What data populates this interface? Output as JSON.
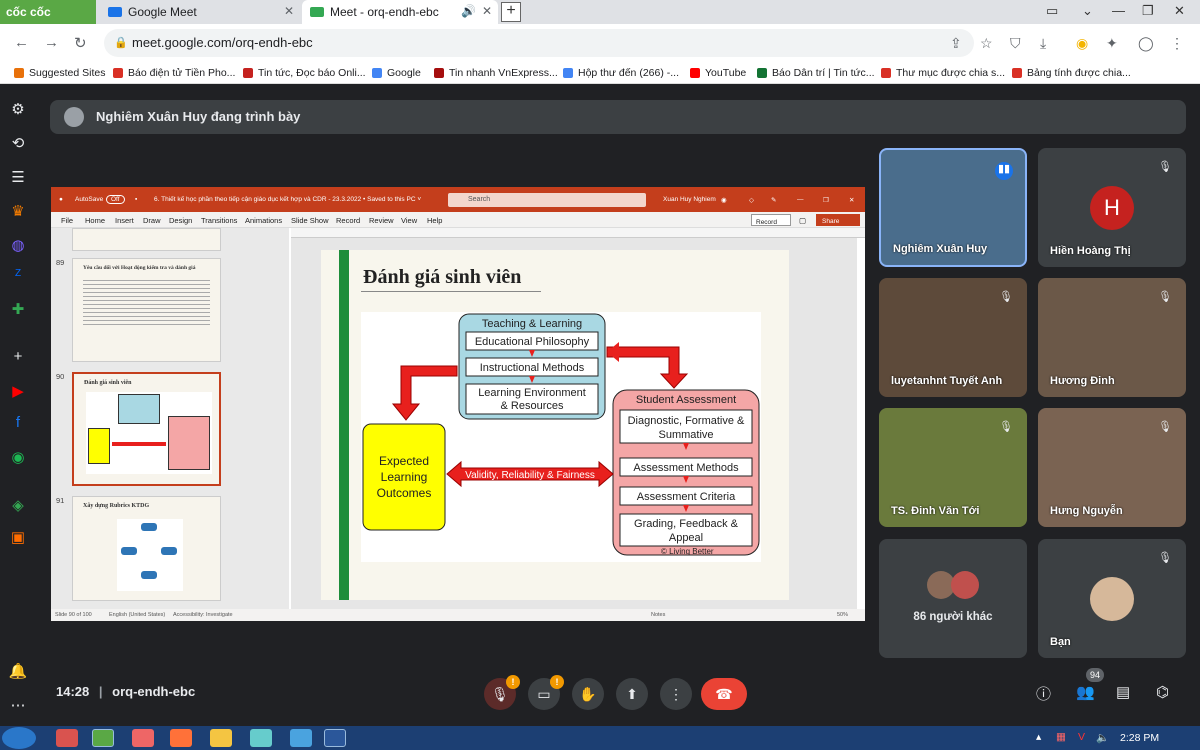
{
  "browser": {
    "logo": "cốc cốc",
    "tabs": [
      {
        "title": "Google Meet",
        "color": "#1a73e8"
      },
      {
        "title": "Meet - orq-endh-ebc",
        "color": "#34a853"
      }
    ],
    "new_tab": "+",
    "url": "meet.google.com/orq-endh-ebc",
    "bookmarks": [
      {
        "label": "Suggested Sites",
        "color": "#e8710a"
      },
      {
        "label": "Báo điện tử Tiền Pho...",
        "color": "#d93025"
      },
      {
        "label": "Tin tức, Đọc báo Onli...",
        "color": "#c5221f"
      },
      {
        "label": "Google",
        "color": "#4285f4"
      },
      {
        "label": "Tin nhanh VnExpress...",
        "color": "#a50e0e"
      },
      {
        "label": "Hộp thư đến (266) -...",
        "color": "#4285f4"
      },
      {
        "label": "YouTube",
        "color": "#ff0000"
      },
      {
        "label": "Báo Dân trí | Tin tức...",
        "color": "#137333"
      },
      {
        "label": "Thư mục được chia s...",
        "color": "#d93025"
      },
      {
        "label": "Bảng tính được chia...",
        "color": "#d93025"
      }
    ]
  },
  "presenting": "Nghiêm Xuân Huy đang trình bày",
  "ppt": {
    "autosave": "AutoSave",
    "autosave_state": "Off",
    "filename": "6. Thiết kế học phần theo tiếp cận giáo dục kết hợp và CDR - 23.3.2022 • Saved to this PC ˅",
    "search": "Search",
    "user": "Xuan Huy Nghiem",
    "menu": [
      "File",
      "Home",
      "Insert",
      "Draw",
      "Design",
      "Transitions",
      "Animations",
      "Slide Show",
      "Record",
      "Review",
      "View",
      "Help"
    ],
    "record": "Record",
    "share": "Share",
    "thumbs": [
      {
        "num": "89",
        "title": "Yêu cầu đối với Hoạt động kiểm tra và đánh giá"
      },
      {
        "num": "90",
        "title": "Đánh giá sinh viên"
      },
      {
        "num": "91",
        "title": "Xây dựng Rubrics KTDG"
      }
    ],
    "status": {
      "slide": "Slide 90 of 100",
      "lang": "English (United States)",
      "access": "Accessibility: Investigate",
      "notes": "Notes",
      "zoom": "50%"
    },
    "slide": {
      "title": "Đánh giá sinh viên",
      "tl_header": "Teaching & Learning",
      "tl_items": [
        "Educational Philosophy",
        "Instructional Methods",
        "Learning Environment",
        "& Resources"
      ],
      "sa_header": "Student Assessment",
      "sa_items": [
        "Diagnostic, Formative &",
        "Summative",
        "Assessment Methods",
        "Assessment Criteria",
        "Grading, Feedback &",
        "Appeal"
      ],
      "elo": [
        "Expected",
        "Learning",
        "Outcomes"
      ],
      "validity": "Validity, Reliability & Fairness",
      "copyright": "© Living Better"
    }
  },
  "participants": [
    {
      "name": "Nghiêm Xuân Huy",
      "bg": "#4a6d8c"
    },
    {
      "name": "Hiền Hoàng Thị",
      "initial": "H"
    },
    {
      "name": "luyetanhnt Tuyết Anh",
      "bg": "#5d4a3a"
    },
    {
      "name": "Hương Đinh",
      "bg": "#6b5848"
    },
    {
      "name": "TS. Đinh Văn Tới",
      "bg": "#6a7a3c"
    },
    {
      "name": "Hưng Nguyễn",
      "bg": "#7a6352"
    },
    {
      "name": "86 người khác"
    },
    {
      "name": "Bạn"
    }
  ],
  "meeting": {
    "time": "14:28",
    "separator": "|",
    "code": "orq-endh-ebc",
    "people_count": "94",
    "badge": "!"
  },
  "taskbar": {
    "time": "2:28 PM"
  }
}
